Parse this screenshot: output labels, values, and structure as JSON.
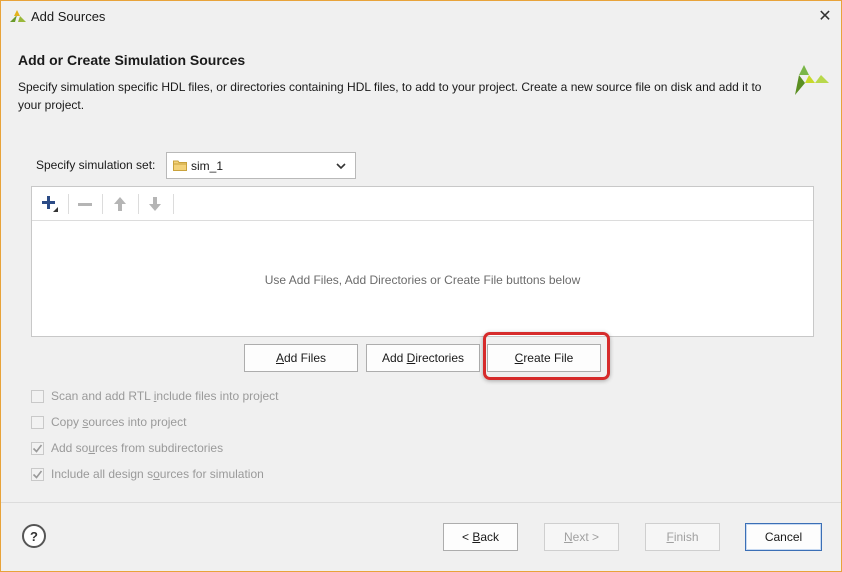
{
  "window": {
    "title": "Add Sources",
    "close_glyph": "✕"
  },
  "page": {
    "title": "Add or Create Simulation Sources",
    "description": "Specify simulation specific HDL files, or directories containing HDL files, to add to your project. Create a new source file on disk and add it to your project."
  },
  "simset": {
    "label": "Specify simulation set:",
    "value": "sim_1"
  },
  "list": {
    "toolbar": {
      "add_icon": "plus-icon",
      "remove_icon": "minus-icon",
      "up_icon": "arrow-up-icon",
      "down_icon": "arrow-down-icon"
    },
    "empty_hint": "Use Add Files, Add Directories or Create File buttons below"
  },
  "actions": {
    "add_files": {
      "label": "Add Files",
      "mnemonic": "A",
      "rest": "dd Files"
    },
    "add_directories": {
      "label": "Add Directories",
      "pre": "Add ",
      "mnemonic": "D",
      "rest": "irectories"
    },
    "create_file": {
      "label": "Create File",
      "mnemonic": "C",
      "rest": "reate File"
    }
  },
  "options": [
    {
      "pre": "Scan and add RTL ",
      "mnemonic": "i",
      "rest": "nclude files into project",
      "checked": false
    },
    {
      "pre": "Copy ",
      "mnemonic": "s",
      "rest": "ources into project",
      "checked": false
    },
    {
      "pre": "Add so",
      "mnemonic": "u",
      "rest": "rces from subdirectories",
      "checked": true
    },
    {
      "pre": "Include all design s",
      "mnemonic": "o",
      "rest": "urces for simulation",
      "checked": true
    }
  ],
  "footer": {
    "help": "?",
    "back": {
      "pre": "< ",
      "mnemonic": "B",
      "rest": "ack"
    },
    "next": {
      "mnemonic": "N",
      "rest": "ext >"
    },
    "finish": {
      "mnemonic": "F",
      "rest": "inish"
    },
    "cancel": "Cancel"
  },
  "colors": {
    "window_border": "#e8a33a",
    "highlight": "#d62b2b",
    "logo_green": "#7ab648",
    "logo_yellow": "#c8d92a"
  }
}
